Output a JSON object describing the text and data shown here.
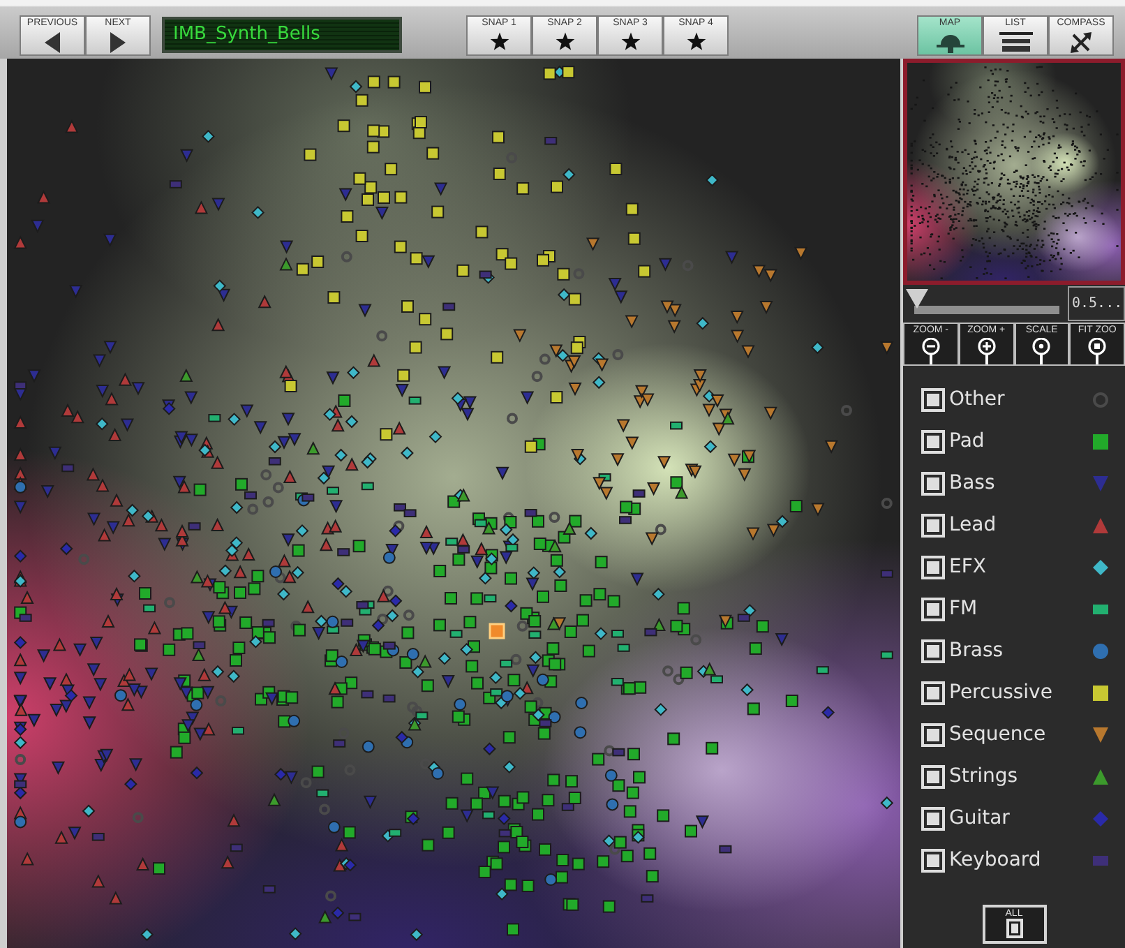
{
  "toolbar": {
    "nav_buttons": [
      {
        "label": "PREVIOUS",
        "kind": "back"
      },
      {
        "label": "NEXT",
        "kind": "forward"
      }
    ],
    "preset_display": "IMB_Synth_Bells",
    "snapshots": [
      {
        "label": "SNAP 1"
      },
      {
        "label": "SNAP 2"
      },
      {
        "label": "SNAP 3"
      },
      {
        "label": "SNAP 4"
      }
    ],
    "views": [
      {
        "label": "MAP",
        "kind": "map",
        "selected": true
      },
      {
        "label": "LIST",
        "kind": "list",
        "selected": false
      },
      {
        "label": "COMPASS",
        "kind": "compass",
        "selected": false
      }
    ]
  },
  "zoom": {
    "slider": {
      "level": 0
    },
    "reading": "0.5...",
    "buttons": [
      {
        "label": "ZOOM -",
        "kind": "out"
      },
      {
        "label": "ZOOM +",
        "kind": "in"
      },
      {
        "label": "SCALE",
        "kind": "scale"
      },
      {
        "label": "FIT ZOO",
        "kind": "fit"
      }
    ]
  },
  "legend": [
    {
      "label": "Other",
      "kind": "ring",
      "color": "#4a4a4a",
      "checked": true
    },
    {
      "label": "Pad",
      "kind": "square",
      "color": "#22aa2a",
      "checked": true
    },
    {
      "label": "Bass",
      "kind": "down",
      "color": "#2d2d92",
      "checked": true
    },
    {
      "label": "Lead",
      "kind": "up",
      "color": "#b03a3a",
      "checked": true
    },
    {
      "label": "EFX",
      "kind": "diamond",
      "color": "#3fb8c8",
      "checked": true
    },
    {
      "label": "FM",
      "kind": "bar",
      "color": "#22b070",
      "checked": true
    },
    {
      "label": "Brass",
      "kind": "circle",
      "color": "#2f6fb0",
      "checked": true
    },
    {
      "label": "Percussive",
      "kind": "square",
      "color": "#c8c832",
      "checked": true
    },
    {
      "label": "Sequence",
      "kind": "down",
      "color": "#b8782e",
      "checked": true
    },
    {
      "label": "Strings",
      "kind": "up",
      "color": "#3c9a2c",
      "checked": true
    },
    {
      "label": "Guitar",
      "kind": "diamond",
      "color": "#2a2aa8",
      "checked": true
    },
    {
      "label": "Keyboard",
      "kind": "bar",
      "color": "#3e2f78",
      "checked": true
    }
  ],
  "all_button": {
    "label": "ALL",
    "checked": true
  }
}
